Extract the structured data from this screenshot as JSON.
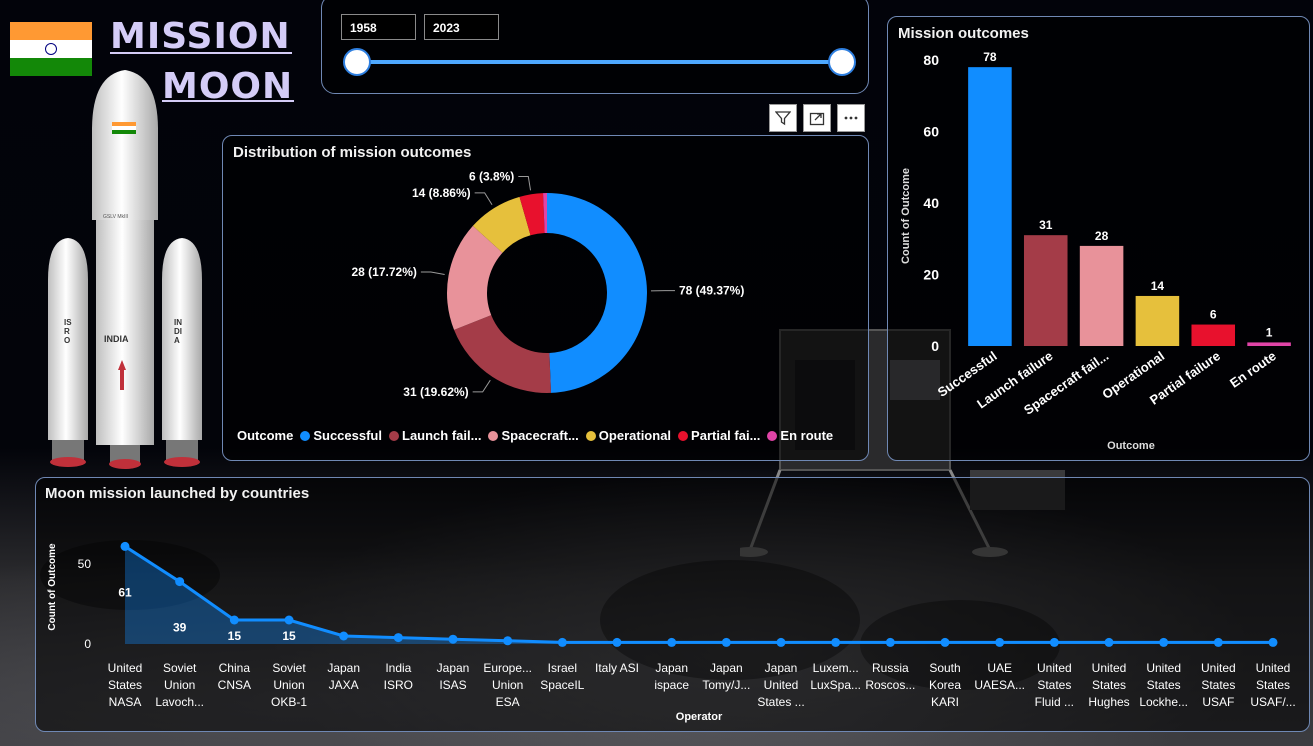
{
  "header": {
    "title_line1": "MISSION",
    "title_line2": "MOON",
    "flag_colors": [
      "#ff9933",
      "#ffffff",
      "#138808"
    ],
    "chakra_color": "#000080"
  },
  "rocket": {
    "body_text": "INDIA",
    "booster_left_text": "ISRO",
    "booster_right_text": "INDIA",
    "model_text": "GSLV MkIII"
  },
  "year_slider": {
    "start": "1958",
    "end": "2023",
    "accent": "#4ea8ff"
  },
  "toolbar": {
    "filter_icon": "filter-icon",
    "focus_icon": "focus-mode-icon",
    "more_icon": "more-options-icon"
  },
  "donut": {
    "title": "Distribution of mission outcomes",
    "legend_title": "Outcome",
    "legend_items": [
      "Successful",
      "Launch fail...",
      "Spacecraft...",
      "Operational",
      "Partial fai...",
      "En route"
    ]
  },
  "bar": {
    "title": "Mission outcomes"
  },
  "line": {
    "title": "Moon mission launched by countries"
  },
  "chart_data": [
    {
      "type": "pie",
      "title": "Distribution of mission outcomes",
      "legend_title": "Outcome",
      "categories": [
        "Successful",
        "Launch failure",
        "Spacecraft failure",
        "Operational",
        "Partial failure",
        "En route"
      ],
      "values": [
        78,
        31,
        28,
        14,
        6,
        1
      ],
      "labels": [
        "78 (49.37%)",
        "31 (19.62%)",
        "28 (17.72%)",
        "14 (8.86%)",
        "6 (3.8%)",
        ""
      ],
      "colors": [
        "#118dff",
        "#a43c48",
        "#e8929a",
        "#e6c03c",
        "#e8112d",
        "#e044a7"
      ]
    },
    {
      "type": "bar",
      "title": "Mission outcomes",
      "categories": [
        "Successful",
        "Launch failure",
        "Spacecraft fail...",
        "Operational",
        "Partial failure",
        "En route"
      ],
      "values": [
        78,
        31,
        28,
        14,
        6,
        1
      ],
      "colors": [
        "#118dff",
        "#a43c48",
        "#e8929a",
        "#e6c03c",
        "#e8112d",
        "#e044a7"
      ],
      "xlabel": "Outcome",
      "ylabel": "Count of Outcome",
      "yticks": [
        0,
        20,
        40,
        60,
        80
      ],
      "ylim": [
        0,
        80
      ]
    },
    {
      "type": "area",
      "title": "Moon mission launched by countries",
      "xlabel": "Operator",
      "ylabel": "Count of Outcome",
      "yticks": [
        0,
        50
      ],
      "ylim": [
        0,
        70
      ],
      "color": "#118dff",
      "categories": [
        [
          "United",
          "States",
          "NASA"
        ],
        [
          "Soviet",
          "Union",
          "Lavoch..."
        ],
        [
          "China",
          "CNSA"
        ],
        [
          "Soviet",
          "Union",
          "OKB-1"
        ],
        [
          "Japan",
          "JAXA"
        ],
        [
          "India",
          "ISRO"
        ],
        [
          "Japan",
          "ISAS"
        ],
        [
          "Europe...",
          "Union",
          "ESA"
        ],
        [
          "Israel",
          "SpaceIL"
        ],
        [
          "Italy ASI"
        ],
        [
          "Japan",
          "ispace"
        ],
        [
          "Japan",
          "Tomy/J..."
        ],
        [
          "Japan",
          "United",
          "States ..."
        ],
        [
          "Luxem...",
          "LuxSpa..."
        ],
        [
          "Russia",
          "Roscos..."
        ],
        [
          "South",
          "Korea",
          "KARI"
        ],
        [
          "UAE",
          "UAESA..."
        ],
        [
          "United",
          "States",
          "Fluid ..."
        ],
        [
          "United",
          "States",
          "Hughes"
        ],
        [
          "United",
          "States",
          "Lockhe..."
        ],
        [
          "United",
          "States",
          "USAF"
        ],
        [
          "United",
          "States",
          "USAF/..."
        ]
      ],
      "values": [
        61,
        39,
        15,
        15,
        5,
        4,
        3,
        2,
        1,
        1,
        1,
        1,
        1,
        1,
        1,
        1,
        1,
        1,
        1,
        1,
        1,
        1
      ],
      "data_labels": [
        "61",
        "39",
        "15",
        "15",
        "",
        "",
        "",
        "",
        "",
        "",
        "",
        "",
        "",
        "",
        "",
        "",
        "",
        "",
        "",
        "",
        "",
        ""
      ]
    }
  ]
}
